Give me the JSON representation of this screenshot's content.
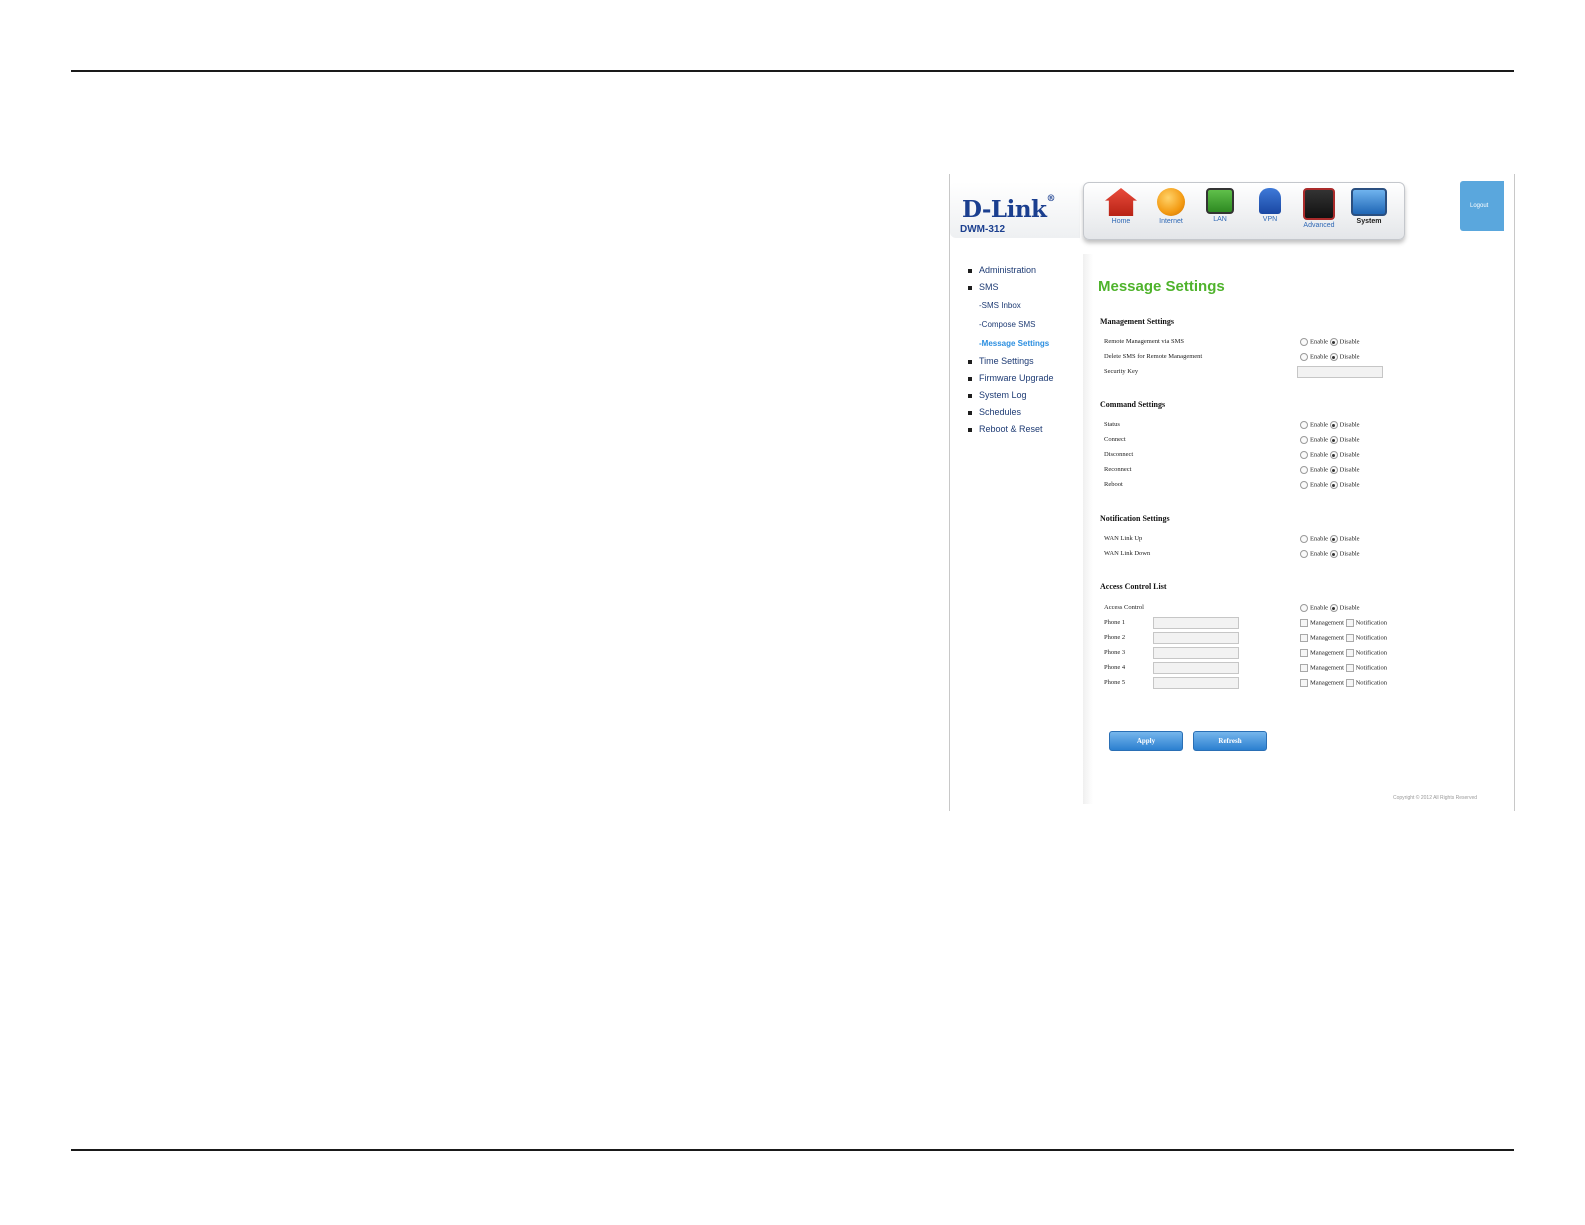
{
  "router": {
    "brand": "D-Link",
    "model": "DWM-312",
    "logout_label": "Logout",
    "copyright": "Copyright © 2012  All Rights Reserved"
  },
  "nav": [
    {
      "label": "Home",
      "icon": "home-icon",
      "active": false
    },
    {
      "label": "Internet",
      "icon": "globe-icon",
      "active": false
    },
    {
      "label": "LAN",
      "icon": "lan-icon",
      "active": false
    },
    {
      "label": "VPN",
      "icon": "lock-icon",
      "active": false
    },
    {
      "label": "Advanced",
      "icon": "tools-icon",
      "active": false
    },
    {
      "label": "System",
      "icon": "computer-icon",
      "active": true
    }
  ],
  "sidebar": {
    "administration": "Administration",
    "sms": "SMS",
    "sms_inbox": "-SMS Inbox",
    "compose_sms": "-Compose SMS",
    "message_settings": "-Message Settings",
    "time_settings": "Time Settings",
    "firmware_upgrade": "Firmware Upgrade",
    "system_log": "System Log",
    "schedules": "Schedules",
    "reboot_reset": "Reboot & Reset"
  },
  "page": {
    "title": "Message Settings",
    "enable_label": "Enable",
    "disable_label": "Disable",
    "management_label": "Management",
    "notification_label": "Notification",
    "management_settings": {
      "heading": "Management Settings",
      "remote_management": "Remote Management via SMS",
      "delete_sms": "Delete SMS for Remote Management",
      "security_key": "Security Key",
      "security_key_value": ""
    },
    "command_settings": {
      "heading": "Command Settings",
      "status": "Status",
      "connect": "Connect",
      "disconnect": "Disconnect",
      "reconnect": "Reconnect",
      "reboot": "Reboot"
    },
    "notification_settings": {
      "heading": "Notification Settings",
      "wan_link_up": "WAN Link Up",
      "wan_link_down": "WAN Link Down"
    },
    "access_control_list": {
      "heading": "Access Control List",
      "access_control": "Access Control",
      "phone1": "Phone 1",
      "phone2": "Phone 2",
      "phone3": "Phone 3",
      "phone4": "Phone 4",
      "phone5": "Phone 5"
    },
    "apply_label": "Apply",
    "refresh_label": "Refresh"
  },
  "colors": {
    "title_green": "#4fb32c",
    "link_blue": "#2a8ee0",
    "button_blue": "#2b7fd0",
    "brand_navy": "#1b3f8f"
  }
}
